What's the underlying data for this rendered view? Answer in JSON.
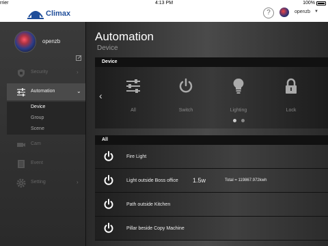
{
  "status_bar": {
    "carrier": "rrier",
    "time": "4:13 PM",
    "battery": "100%"
  },
  "header": {
    "logo_text": "Climax",
    "help_icon": "?",
    "username": "openzb"
  },
  "sidebar": {
    "username": "openzb",
    "nav": [
      {
        "label": "Security",
        "icon": "shield-icon"
      },
      {
        "label": "Automation",
        "icon": "sliders-icon"
      },
      {
        "label": "Cam",
        "icon": "camera-icon"
      },
      {
        "label": "Event",
        "icon": "list-icon"
      },
      {
        "label": "Setting",
        "icon": "gear-icon"
      }
    ],
    "subnav": [
      "Device",
      "Group",
      "Scene"
    ]
  },
  "main": {
    "title": "Automation",
    "subtitle": "Device",
    "device_panel_title": "Device",
    "categories": [
      {
        "label": "All",
        "icon": "sliders-icon"
      },
      {
        "label": "Switch",
        "icon": "power-icon"
      },
      {
        "label": "Lighting",
        "icon": "bulb-icon"
      },
      {
        "label": "Lock",
        "icon": "lock-icon"
      }
    ],
    "list_title": "All",
    "devices": [
      {
        "name": "Fire Light",
        "power": "",
        "total": ""
      },
      {
        "name": "Light outside Boss office",
        "power": "1.5w",
        "total": "Total = 119867.972kwh"
      },
      {
        "name": "Path outside Kitchen",
        "power": "",
        "total": ""
      },
      {
        "name": "Pillar beside Copy Machine",
        "power": "",
        "total": ""
      }
    ]
  },
  "colors": {
    "brand": "#1f4e9a",
    "panel_header": "#111111",
    "sidebar_active": "#4a4a4a"
  }
}
